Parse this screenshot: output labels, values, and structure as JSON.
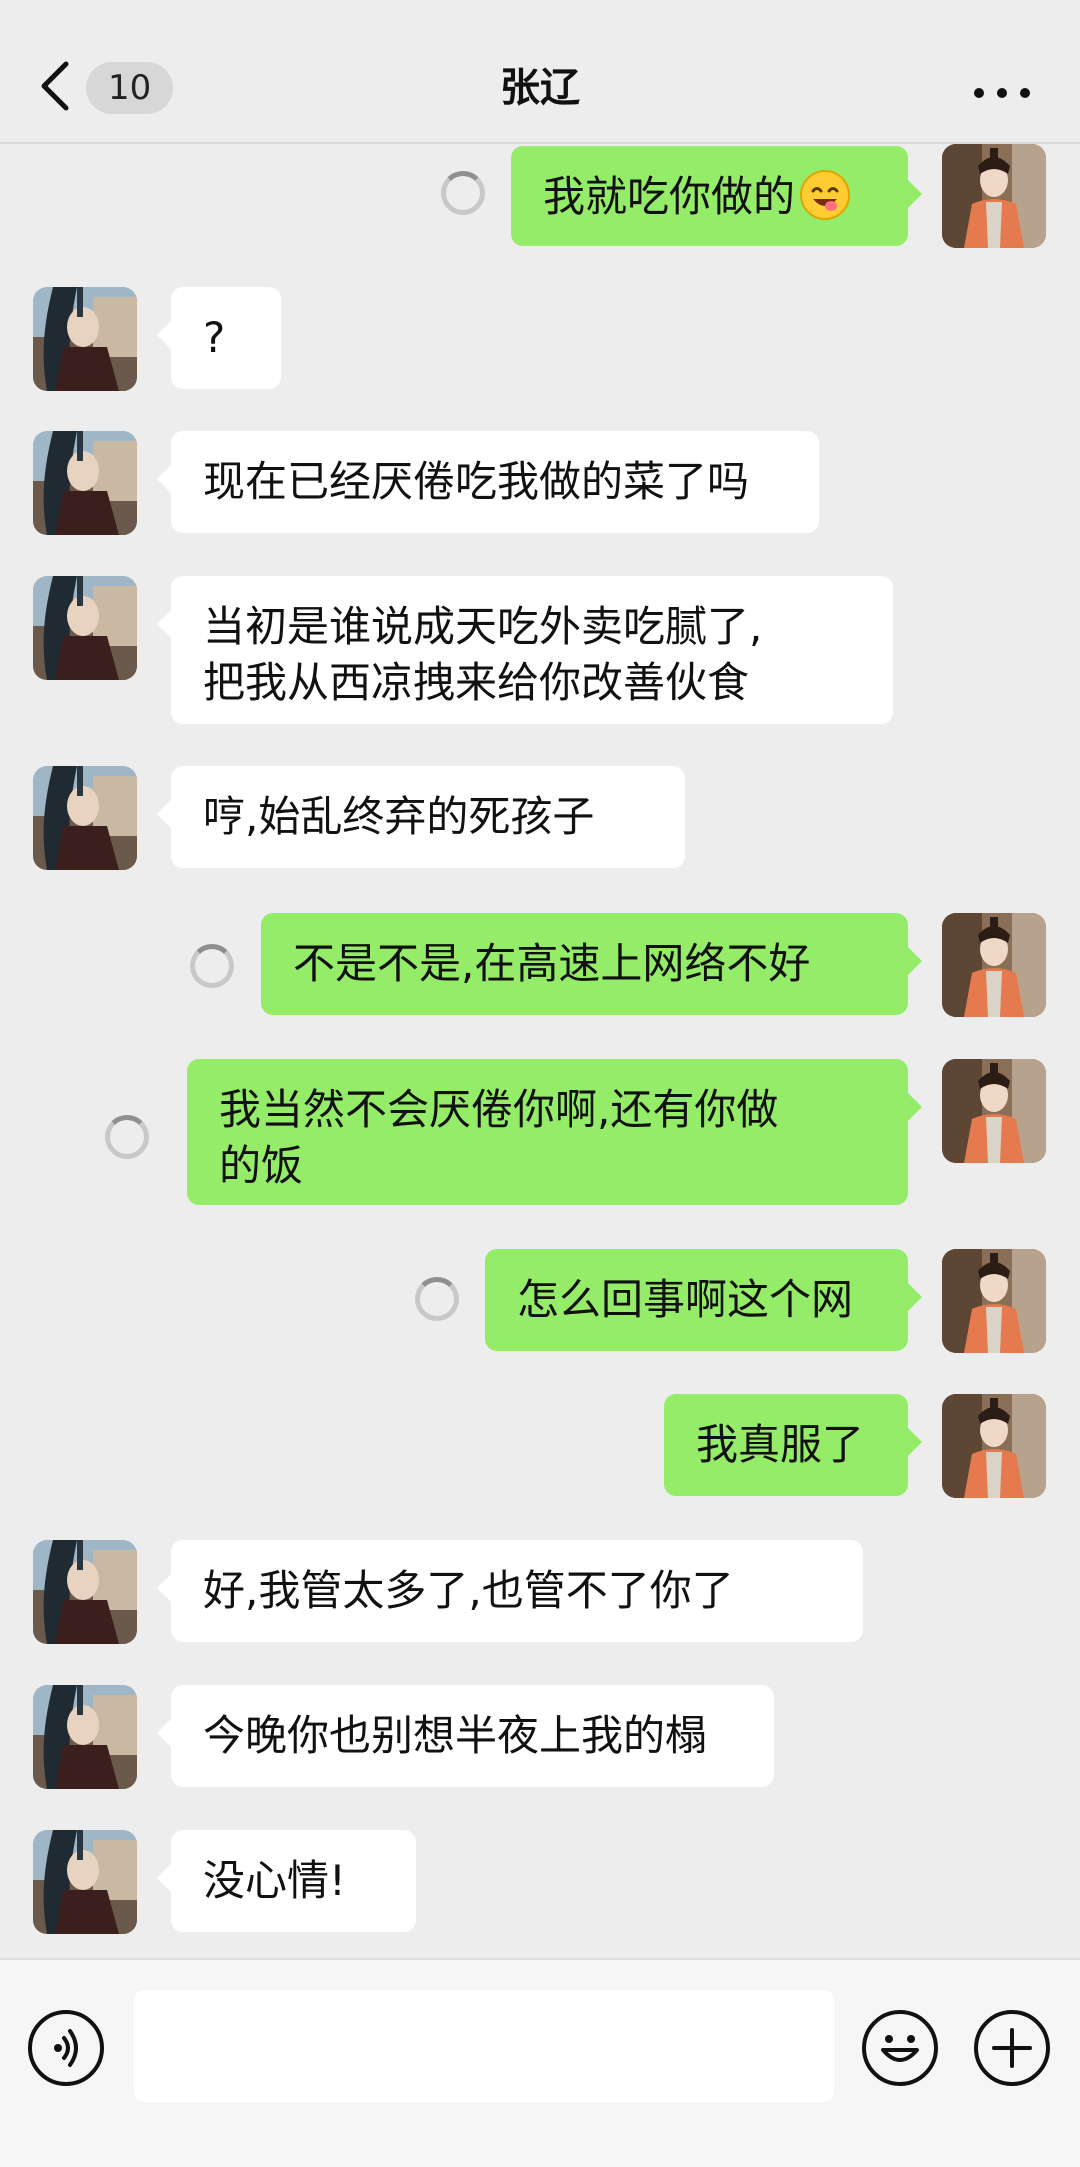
{
  "header": {
    "back_icon": "chevron-left-icon",
    "unread_count": "10",
    "title": "张辽",
    "more_icon": "more-dots-icon"
  },
  "messages": [
    {
      "side": "right",
      "text": "我就吃你做的",
      "emoji": "yum-face-emoji",
      "status": "sending"
    },
    {
      "side": "left",
      "text": "?"
    },
    {
      "side": "left",
      "text": "现在已经厌倦吃我做的菜了吗"
    },
    {
      "side": "left",
      "line1": "当初是谁说成天吃外卖吃腻了,",
      "line2": "把我从西凉拽来给你改善伙食"
    },
    {
      "side": "left",
      "text": "哼,始乱终弃的死孩子"
    },
    {
      "side": "right",
      "text": "不是不是,在高速上网络不好",
      "status": "sending"
    },
    {
      "side": "right",
      "line1": "我当然不会厌倦你啊,还有你做",
      "line2": "的饭",
      "status": "sending"
    },
    {
      "side": "right",
      "text": "怎么回事啊这个网",
      "status": "sending"
    },
    {
      "side": "right",
      "text": "我真服了"
    },
    {
      "side": "left",
      "text": "好,我管太多了,也管不了你了"
    },
    {
      "side": "left",
      "text": "今晚你也别想半夜上我的榻"
    },
    {
      "side": "left",
      "text": "没心情!"
    }
  ],
  "bottom_bar": {
    "voice_icon": "voice-icon",
    "input_value": "",
    "emoji_icon": "smiley-icon",
    "plus_icon": "plus-icon"
  },
  "colors": {
    "background": "#ededed",
    "sent_bubble": "#95ec69",
    "received_bubble": "#ffffff"
  }
}
